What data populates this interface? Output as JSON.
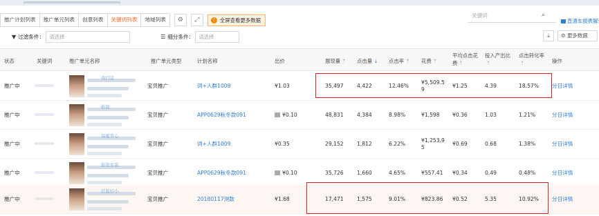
{
  "tabs": [
    {
      "label": "推广计划列表",
      "active": false
    },
    {
      "label": "推广单元列表",
      "active": false
    },
    {
      "label": "创意列表",
      "active": false
    },
    {
      "label": "关键词列表",
      "active": true
    },
    {
      "label": "地域列表",
      "active": false
    }
  ],
  "notice": {
    "text": "全屏查看更多数据"
  },
  "search": {
    "placeholder": "关键词"
  },
  "ztc_link": "直通车报表解读",
  "filters": {
    "filter_label": "过滤条件：",
    "filter_placeholder": "请选择",
    "breakdown_label": "细分条件：",
    "breakdown_placeholder": "请选择"
  },
  "more_data": "更多数据",
  "columns": {
    "status": "状态",
    "keyword": "关键词",
    "unit_name": "推广单元名称",
    "unit_type": "推广单元类型",
    "plan_name": "计划名称",
    "bid": "出价",
    "impressions": "展现量",
    "clicks": "点击量",
    "ctr": "点击率",
    "cost": "花费",
    "avg_cpc_a": "平均点击花",
    "avg_cpc_b": "费",
    "roi": "投入产出比",
    "conv_a": "点击转化率",
    "action": "操作"
  },
  "rows": [
    {
      "status": "推广中",
      "unit_type": "宝贝推广",
      "plan_name": "词+人群1009",
      "bid": "¥1.03",
      "app": false,
      "impressions": "35,497",
      "clicks": "4,422",
      "ctr": "12.46%",
      "cost_a": "¥5,509.5",
      "cost_b": "9",
      "cpc": "¥1.25",
      "roi": "4.39",
      "conv": "18.57%",
      "action": "分日详情",
      "unit_blur": "商打底",
      "highlight": false
    },
    {
      "status": "推广中",
      "unit_type": "宝贝推广",
      "plan_name": "APP0629秋冬款091",
      "bid": "¥0.10",
      "app": true,
      "impressions": "48,831",
      "clicks": "4,384",
      "ctr": "8.98%",
      "cost_a": "¥1,598",
      "cost_b": "",
      "cpc": "¥0.36",
      "roi": "1.03",
      "conv": "1.21%",
      "action": "分日详情",
      "unit_blur": "新款",
      "highlight": false
    },
    {
      "status": "推广中",
      "unit_type": "宝贝推广",
      "plan_name": "词+人群1009",
      "bid": "¥0.35",
      "app": false,
      "impressions": "29,152",
      "clicks": "1,812",
      "ctr": "6.22%",
      "cost_a": "¥1,253.9",
      "cost_b": "5",
      "cpc": "¥0.69",
      "roi": "0.68",
      "conv": "1.38%",
      "action": "分日详情",
      "unit_blur": "保暖背心",
      "highlight": false
    },
    {
      "status": "推广中",
      "unit_type": "宝贝推广",
      "plan_name": "APP0629秋冬款091",
      "bid": "¥0.10",
      "app": true,
      "impressions": "35,726",
      "clicks": "1,660",
      "ctr": "4.65%",
      "cost_a": "¥557.41",
      "cost_b": "",
      "cpc": "¥0.34",
      "roi": "0.49",
      "conv": "0.48%",
      "action": "分日详情",
      "unit_blur": "新款女装",
      "highlight": false
    },
    {
      "status": "推广中",
      "unit_type": "宝贝推广",
      "plan_name": "20180117测款",
      "bid": "¥1.68",
      "app": false,
      "impressions": "17,471",
      "clicks": "1,575",
      "ctr": "9.01%",
      "cost_a": "¥823.86",
      "cost_b": "",
      "cpc": "¥0.52",
      "roi": "5.35",
      "conv": "10.92%",
      "action": "分日详情",
      "unit_blur": "打底衫小",
      "highlight": true
    }
  ],
  "colors": {
    "accent": "#ff6a2a",
    "link": "#2f7fd3",
    "highlight_border": "#e02020",
    "notice_bg": "#fff4e6"
  },
  "icons": [
    "settings-icon",
    "fullscreen-icon",
    "alert-icon",
    "search-icon",
    "filter-icon",
    "list-icon",
    "download-icon",
    "gear-icon",
    "app-icon"
  ]
}
